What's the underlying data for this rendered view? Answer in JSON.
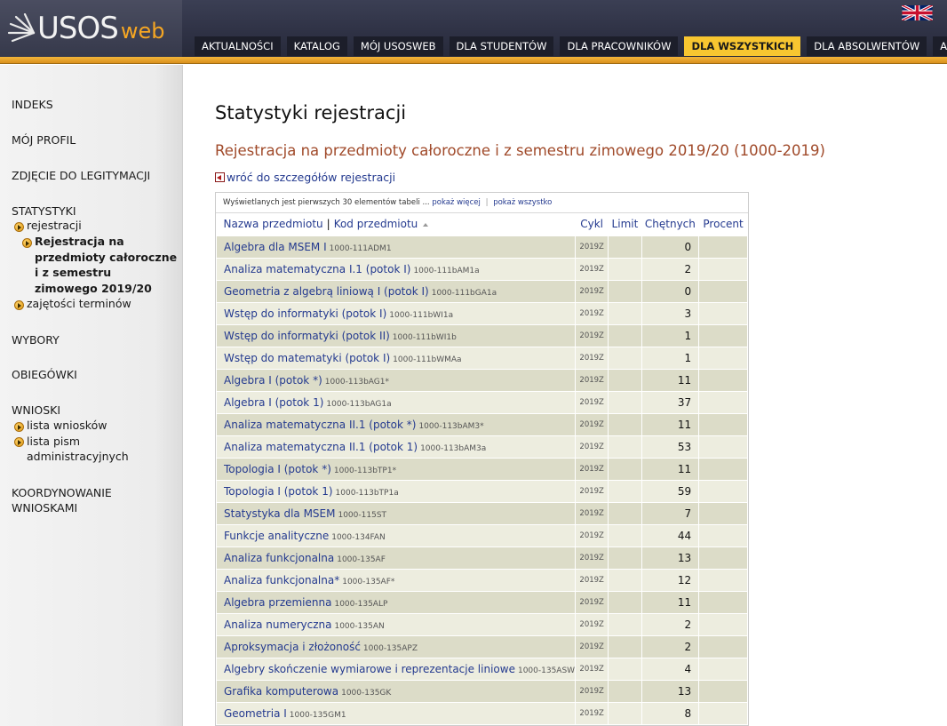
{
  "header": {
    "logo_main": "USOS",
    "logo_sub": "web",
    "language_flag": "uk-flag-icon",
    "colors": {
      "accent": "#f5a623",
      "active_tab": "#f8c630",
      "stripe": "#e6a42c"
    },
    "nav": [
      {
        "label": "AKTUALNOŚCI",
        "active": false
      },
      {
        "label": "KATALOG",
        "active": false
      },
      {
        "label": "MÓJ USOSWEB",
        "active": false
      },
      {
        "label": "DLA STUDENTÓW",
        "active": false
      },
      {
        "label": "DLA PRACOWNIKÓW",
        "active": false
      },
      {
        "label": "DLA WSZYSTKICH",
        "active": true
      },
      {
        "label": "DLA ABSOLWENTÓW",
        "active": false
      },
      {
        "label": "ADMIN",
        "active": false
      }
    ]
  },
  "sidebar": {
    "indeks": "INDEKS",
    "moj_profil": "MÓJ PROFIL",
    "zdjecie": "ZDJĘCIE DO LEGITYMACJI",
    "statystyki": "STATYSTYKI",
    "rejestracji": "rejestracji",
    "current_line1": "Rejestracja na",
    "current_line2": "przedmioty całoroczne",
    "current_line3": "i z semestru",
    "current_line4": "zimowego 2019/20",
    "zajetosci": "zajętości terminów",
    "wybory": "WYBORY",
    "obiegowki": "OBIEGÓWKI",
    "wnioski": "WNIOSKI",
    "lista_wnioskow": "lista wniosków",
    "lista_pism_1": "lista pism",
    "lista_pism_2": "administracyjnych",
    "koord_1": "KOORDYNOWANIE",
    "koord_2": "WNIOSKAMI"
  },
  "main": {
    "title": "Statystyki rejestracji",
    "subtitle": "Rejestracja na przedmioty całoroczne i z semestru zimowego 2019/20 (1000-2019)",
    "back_link": "wróć do szczegółów rejestracji",
    "info_text": "Wyświetlanych jest pierwszych 30 elementów tabeli ...",
    "show_more": "pokaż więcej",
    "show_all": "pokaż wszystko",
    "info_sep": "|",
    "col_name": "Nazwa przedmiotu",
    "col_sep": "|",
    "col_code": "Kod przedmiotu",
    "col_cycle": "Cykl",
    "col_limit": "Limit",
    "col_count": "Chętnych",
    "col_percent": "Procent",
    "rows": [
      {
        "name": "Algebra dla MSEM I",
        "code": "1000-111ADM1",
        "cycle": "2019Z",
        "count": "0"
      },
      {
        "name": "Analiza matematyczna I.1 (potok I)",
        "code": "1000-111bAM1a",
        "cycle": "2019Z",
        "count": "2"
      },
      {
        "name": "Geometria z algebrą liniową I (potok I)",
        "code": "1000-111bGA1a",
        "cycle": "2019Z",
        "count": "0"
      },
      {
        "name": "Wstęp do informatyki (potok I)",
        "code": "1000-111bWI1a",
        "cycle": "2019Z",
        "count": "3"
      },
      {
        "name": "Wstęp do informatyki (potok II)",
        "code": "1000-111bWI1b",
        "cycle": "2019Z",
        "count": "1"
      },
      {
        "name": "Wstęp do matematyki (potok I)",
        "code": "1000-111bWMAa",
        "cycle": "2019Z",
        "count": "1"
      },
      {
        "name": "Algebra I (potok *)",
        "code": "1000-113bAG1*",
        "cycle": "2019Z",
        "count": "11"
      },
      {
        "name": "Algebra I (potok 1)",
        "code": "1000-113bAG1a",
        "cycle": "2019Z",
        "count": "37"
      },
      {
        "name": "Analiza matematyczna II.1 (potok *)",
        "code": "1000-113bAM3*",
        "cycle": "2019Z",
        "count": "11"
      },
      {
        "name": "Analiza matematyczna II.1 (potok 1)",
        "code": "1000-113bAM3a",
        "cycle": "2019Z",
        "count": "53"
      },
      {
        "name": "Topologia I (potok *)",
        "code": "1000-113bTP1*",
        "cycle": "2019Z",
        "count": "11"
      },
      {
        "name": "Topologia I (potok 1)",
        "code": "1000-113bTP1a",
        "cycle": "2019Z",
        "count": "59"
      },
      {
        "name": "Statystyka dla MSEM",
        "code": "1000-115ST",
        "cycle": "2019Z",
        "count": "7"
      },
      {
        "name": "Funkcje analityczne",
        "code": "1000-134FAN",
        "cycle": "2019Z",
        "count": "44"
      },
      {
        "name": "Analiza funkcjonalna",
        "code": "1000-135AF",
        "cycle": "2019Z",
        "count": "13"
      },
      {
        "name": "Analiza funkcjonalna*",
        "code": "1000-135AF*",
        "cycle": "2019Z",
        "count": "12"
      },
      {
        "name": "Algebra przemienna",
        "code": "1000-135ALP",
        "cycle": "2019Z",
        "count": "11"
      },
      {
        "name": "Analiza numeryczna",
        "code": "1000-135AN",
        "cycle": "2019Z",
        "count": "2"
      },
      {
        "name": "Aproksymacja i złożoność",
        "code": "1000-135APZ",
        "cycle": "2019Z",
        "count": "2"
      },
      {
        "name": "Algebry skończenie wymiarowe i reprezentacje liniowe",
        "code": "1000-135ASW",
        "cycle": "2019Z",
        "count": "4"
      },
      {
        "name": "Grafika komputerowa",
        "code": "1000-135GK",
        "cycle": "2019Z",
        "count": "13"
      },
      {
        "name": "Geometria I",
        "code": "1000-135GM1",
        "cycle": "2019Z",
        "count": "8"
      }
    ]
  }
}
